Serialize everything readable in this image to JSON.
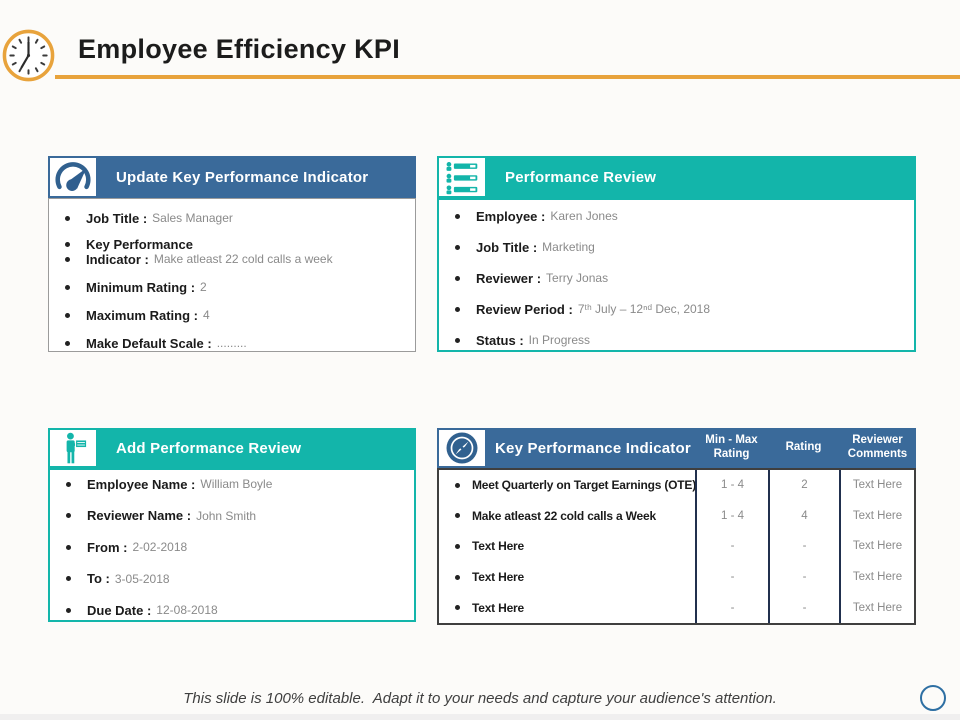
{
  "slide": {
    "title": "Employee Efficiency KPI",
    "footer": "This slide is 100% editable.  Adapt it to your needs and capture your audience's attention."
  },
  "colors": {
    "header-blue": "#3A6A9A",
    "header-teal": "#13B5AA",
    "accent-orange": "#E8A33C",
    "icon-blue": "#31618F",
    "label-black": "#1B1B1B",
    "value-gray": "#8A8A8A",
    "divider-navy": "#21304E",
    "circle-blue": "#2E6FA3"
  },
  "panels": {
    "update_kpi": {
      "title": "Update Key Performance Indicator",
      "icon": "gauge-icon",
      "items": [
        {
          "label": "Job Title :",
          "value": "Sales Manager"
        },
        {
          "label": "Key Performance",
          "value": ""
        },
        {
          "label": "Indicator :",
          "value": "Make atleast 22 cold calls a week"
        },
        {
          "label": "Minimum Rating :",
          "value": "2"
        },
        {
          "label": "Maximum Rating :",
          "value": "4"
        },
        {
          "label": "Make Default Scale :",
          "value": "........."
        }
      ]
    },
    "performance_review": {
      "title": "Performance Review",
      "icon": "people-list-icon",
      "items": [
        {
          "label": "Employee :",
          "value": "Karen Jones"
        },
        {
          "label": "Job Title :",
          "value": "Marketing"
        },
        {
          "label": "Reviewer :",
          "value": "Terry Jonas"
        },
        {
          "label": "Review Period :",
          "value": "7ᵗʰ July – 12ⁿᵈ Dec, 2018"
        },
        {
          "label": "Status :",
          "value": "In Progress"
        }
      ]
    },
    "add_performance_review": {
      "title": "Add Performance Review",
      "icon": "person-sign-icon",
      "items": [
        {
          "label": "Employee Name :",
          "value": "William Boyle"
        },
        {
          "label": "Reviewer Name :",
          "value": "John Smith"
        },
        {
          "label": "From :",
          "value": "2-02-2018"
        },
        {
          "label": "To :",
          "value": "3-05-2018"
        },
        {
          "label": "Due Date :",
          "value": "12-08-2018"
        }
      ]
    },
    "kpi_table": {
      "title": "Key Performance Indicator",
      "icon": "compass-icon",
      "columns": [
        "Min - Max Rating",
        "Rating",
        "Reviewer Comments"
      ],
      "rows": [
        {
          "kpi": "Meet Quarterly on Target Earnings (OTE)",
          "min_max": "1 - 4",
          "rating": "2",
          "comments": "Text Here"
        },
        {
          "kpi": "Make atleast 22 cold calls a Week",
          "min_max": "1 - 4",
          "rating": "4",
          "comments": "Text Here"
        },
        {
          "kpi": "Text Here",
          "min_max": "-",
          "rating": "-",
          "comments": "Text Here"
        },
        {
          "kpi": "Text Here",
          "min_max": "-",
          "rating": "-",
          "comments": "Text Here"
        },
        {
          "kpi": "Text Here",
          "min_max": "-",
          "rating": "-",
          "comments": "Text Here"
        }
      ]
    }
  }
}
